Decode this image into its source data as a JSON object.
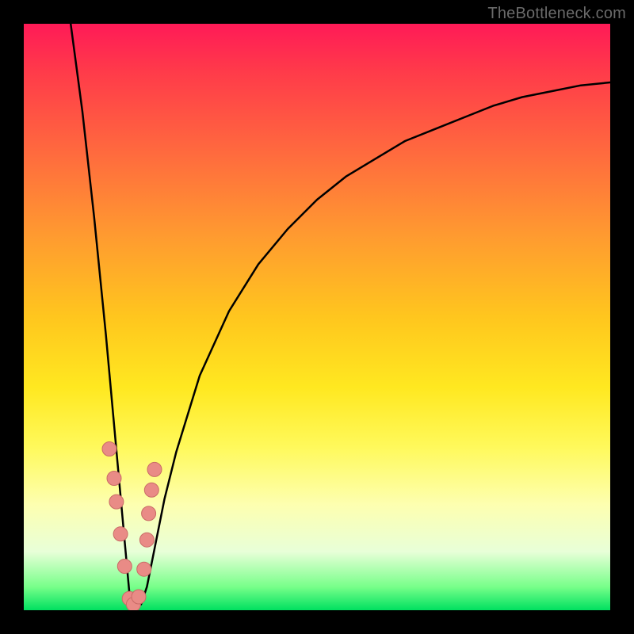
{
  "attribution": "TheBottleneck.com",
  "colors": {
    "frame": "#000000",
    "curve_stroke": "#000000",
    "marker_fill": "#e98b86",
    "marker_stroke": "#c96b66"
  },
  "chart_data": {
    "type": "line",
    "title": "",
    "xlabel": "",
    "ylabel": "",
    "xlim": [
      0,
      100
    ],
    "ylim": [
      0,
      100
    ],
    "notes": "No axes, ticks, or numeric labels are shown. Values below are coordinates in percent of the plot area, read off visually (x: left→right, y: bottom→top). A single V-shaped curve: steep near-vertical descent on the left, minimum near x≈18 y≈0, then an asymptotic rise toward y≈90 at the right edge. Salmon-colored marker dots cluster on both branches near the bottom.",
    "series": [
      {
        "name": "bottleneck-curve",
        "x": [
          8,
          10,
          12,
          14,
          15,
          16,
          17,
          18,
          19,
          20,
          21,
          22,
          23,
          24,
          26,
          30,
          35,
          40,
          45,
          50,
          55,
          60,
          65,
          70,
          75,
          80,
          85,
          90,
          95,
          100
        ],
        "y": [
          100,
          85,
          67,
          47,
          36,
          25,
          14,
          3,
          0.5,
          1,
          4,
          9,
          14,
          19,
          27,
          40,
          51,
          59,
          65,
          70,
          74,
          77,
          80,
          82,
          84,
          86,
          87.5,
          88.5,
          89.5,
          90
        ]
      }
    ],
    "markers": {
      "name": "highlighted-points",
      "color": "#e98b86",
      "x": [
        14.6,
        15.4,
        15.8,
        16.5,
        17.2,
        18.0,
        18.7,
        19.6,
        20.5,
        21.0,
        21.3,
        21.8,
        22.3
      ],
      "y": [
        27.5,
        22.5,
        18.5,
        13.0,
        7.5,
        2.0,
        1.0,
        2.3,
        7.0,
        12.0,
        16.5,
        20.5,
        24.0
      ]
    }
  }
}
